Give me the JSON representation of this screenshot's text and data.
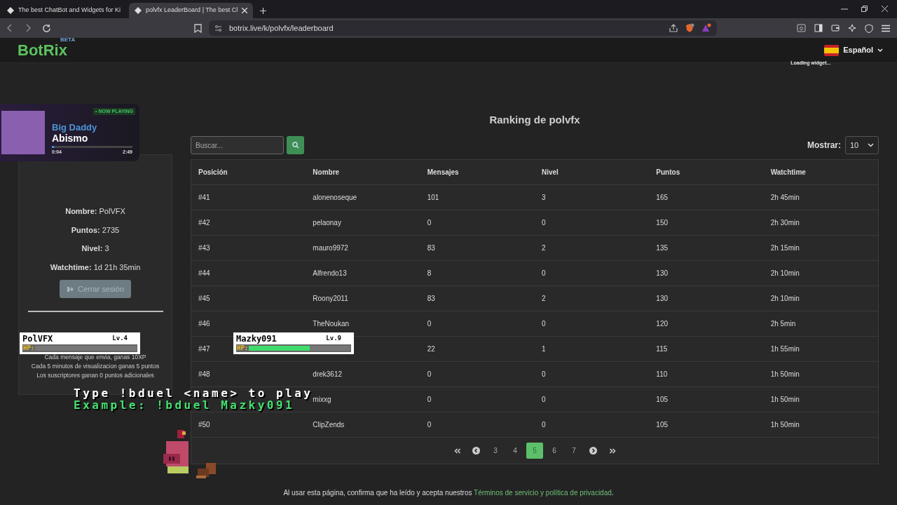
{
  "browser": {
    "tabs": [
      {
        "title": "The best ChatBot and Widgets for Ki",
        "selected": false
      },
      {
        "title": "polvfx LeaderBoard | The best Cl",
        "selected": true
      }
    ],
    "url": "botrix.live/k/polvfx/leaderboard"
  },
  "header": {
    "logo": "BotRix",
    "beta": "BETA",
    "language": "Español",
    "loading": "Loading widget..."
  },
  "now_playing": {
    "badge": "• NOW PLAYING",
    "artist": "Big Daddy",
    "title": "Abismo",
    "elapsed": "0:04",
    "duration": "2:49",
    "level": 0.03
  },
  "profile": {
    "fields": [
      {
        "label": "Nombre:",
        "value": "PolVFX"
      },
      {
        "label": "Puntos:",
        "value": "2735"
      },
      {
        "label": "Nivel:",
        "value": "3"
      },
      {
        "label": "Watchtime:",
        "value": "1d 21h 35min"
      }
    ],
    "logout": "Cerrar sesión",
    "notes": [
      "Cada mensaje que envia, ganas 10XP",
      "Cada 5 minutos de visualizacion ganas 5 puntos",
      "Los suscriptores ganan 0 puntos adicionales"
    ]
  },
  "leaderboard": {
    "title": "Ranking de polvfx",
    "search": {
      "placeholder": "Buscar..."
    },
    "show_label": "Mostrar:",
    "show_value": "10",
    "table": {
      "columns": [
        "Posición",
        "Nombre",
        "Mensajes",
        "Nivel",
        "Puntos",
        "Watchtime"
      ],
      "rows": [
        [
          "#41",
          "alonenoseque",
          "101",
          "3",
          "165",
          "2h 45min"
        ],
        [
          "#42",
          "pelaonay",
          "0",
          "0",
          "150",
          "2h 30min"
        ],
        [
          "#43",
          "mauro9972",
          "83",
          "2",
          "135",
          "2h 15min"
        ],
        [
          "#44",
          "Alfrendo13",
          "8",
          "0",
          "130",
          "2h 10min"
        ],
        [
          "#45",
          "Roony2011",
          "83",
          "2",
          "130",
          "2h 10min"
        ],
        [
          "#46",
          "TheNoukan",
          "0",
          "0",
          "120",
          "2h 5min"
        ],
        [
          "#47",
          null,
          "22",
          "1",
          "115",
          "1h 55min"
        ],
        [
          "#48",
          "drek3612",
          "0",
          "0",
          "110",
          "1h 50min"
        ],
        [
          null,
          "mixxg",
          "0",
          "0",
          "105",
          "1h 50min"
        ],
        [
          "#50",
          "ClipZends",
          "0",
          "0",
          "105",
          "1h 50min"
        ]
      ]
    },
    "pagination": [
      {
        "label": "3",
        "selected": false
      },
      {
        "label": "4",
        "selected": false
      },
      {
        "label": "5",
        "selected": true
      },
      {
        "label": "6",
        "selected": false
      },
      {
        "label": "7",
        "selected": false
      }
    ]
  },
  "duel": {
    "players": [
      {
        "name": "PolVFX",
        "level_text": "Lv.4",
        "hp_label": "HP:",
        "level": 0
      },
      {
        "name": "Mazky091",
        "level_text": "Lv.9",
        "hp_label": "HP:",
        "level": 0.6
      }
    ],
    "instruction": "Type !bduel <name> to play",
    "example": "Example: !bduel Mazky091"
  },
  "footer": {
    "text": "Al usar esta página, confirma que ha leído y acepta nuestros",
    "link": "Términos de servicio y política de privacidad",
    "end": "."
  }
}
